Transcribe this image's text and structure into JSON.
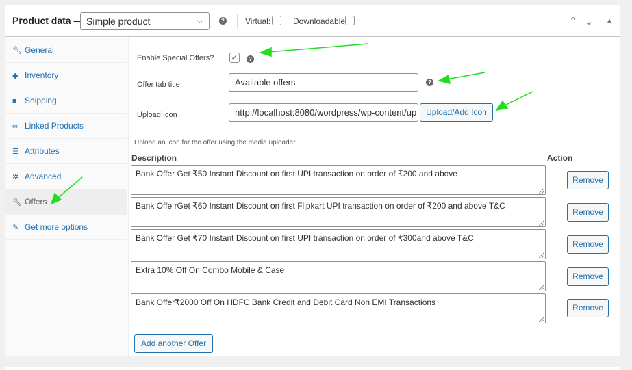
{
  "header": {
    "title": "Product data —",
    "product_type": "Simple product",
    "help_glyph": "?",
    "virtual_label": "Virtual:",
    "downloadable_label": "Downloadable:"
  },
  "sidebar": {
    "items": [
      {
        "label": "General",
        "icon": "wrench-icon"
      },
      {
        "label": "Inventory",
        "icon": "tag-icon"
      },
      {
        "label": "Shipping",
        "icon": "truck-icon"
      },
      {
        "label": "Linked Products",
        "icon": "link-icon"
      },
      {
        "label": "Attributes",
        "icon": "list-icon"
      },
      {
        "label": "Advanced",
        "icon": "gear-icon"
      },
      {
        "label": "Offers",
        "icon": "wrench-icon",
        "active": true
      },
      {
        "label": "Get more options",
        "icon": "plugin-icon"
      }
    ]
  },
  "offers": {
    "enable_label": "Enable Special Offers?",
    "enable_checked": true,
    "tab_title_label": "Offer tab title",
    "tab_title_value": "Available offers",
    "upload_label": "Upload Icon",
    "upload_value": "http://localhost:8080/wordpress/wp-content/up",
    "upload_button": "Upload/Add Icon",
    "upload_note": "Upload an icon for the offer using the media uploader.",
    "col_description": "Description",
    "col_action": "Action",
    "rows": [
      {
        "text": "Bank Offer Get ₹50 Instant Discount on first UPI transaction on order of ₹200 and above",
        "action": "Remove"
      },
      {
        "text": "Bank Offe rGet ₹60 Instant Discount on first Flipkart UPI transaction on order of ₹200 and above T&C",
        "action": "Remove"
      },
      {
        "text": "Bank Offer Get ₹70 Instant Discount on first UPI transaction on order of ₹300and above T&C",
        "action": "Remove"
      },
      {
        "text": "Extra 10% Off On Combo Mobile & Case",
        "action": "Remove"
      },
      {
        "text": "Bank Offer₹2000 Off On HDFC Bank Credit and Debit Card Non EMI Transactions",
        "action": "Remove"
      }
    ],
    "add_button": "Add another Offer"
  },
  "colors": {
    "accent": "#2271b1",
    "annotation_arrow": "#22dd22"
  }
}
